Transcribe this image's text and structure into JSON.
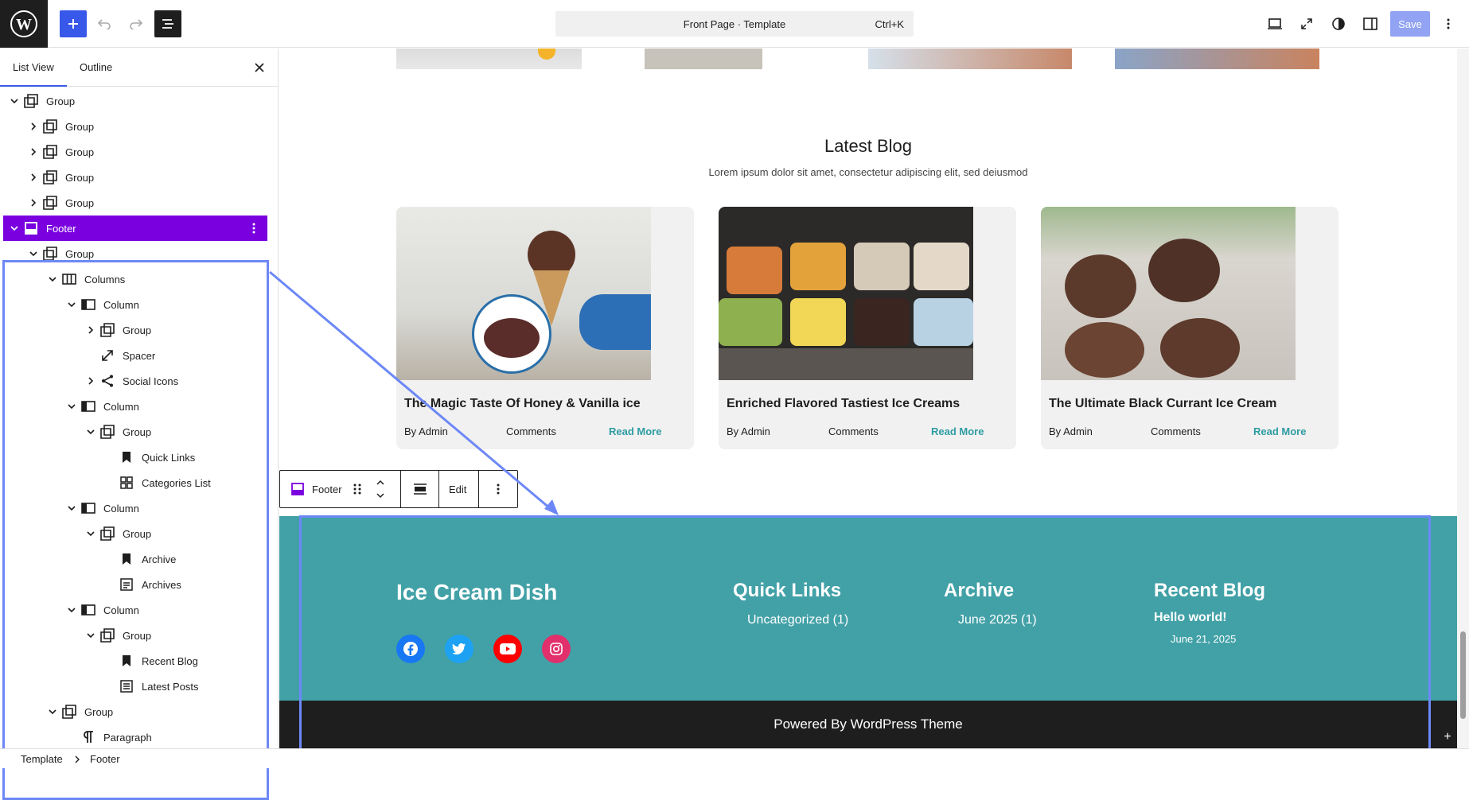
{
  "toolbar": {
    "command_title": "Front Page · Template",
    "command_shortcut": "Ctrl+K",
    "save_label": "Save"
  },
  "sidebar": {
    "tabs": [
      "List View",
      "Outline"
    ],
    "items": [
      {
        "label": "Group",
        "icon": "group-icon"
      },
      {
        "label": "Group",
        "icon": "group-icon"
      },
      {
        "label": "Group",
        "icon": "group-icon"
      },
      {
        "label": "Group",
        "icon": "group-icon"
      },
      {
        "label": "Group",
        "icon": "group-icon"
      },
      {
        "label": "Footer",
        "icon": "template-part-icon"
      },
      {
        "label": "Group",
        "icon": "group-icon"
      },
      {
        "label": "Columns",
        "icon": "columns-icon"
      },
      {
        "label": "Column",
        "icon": "column-icon"
      },
      {
        "label": "Group",
        "icon": "group-icon"
      },
      {
        "label": "Spacer",
        "icon": "spacer-icon"
      },
      {
        "label": "Social Icons",
        "icon": "share-icon"
      },
      {
        "label": "Column",
        "icon": "column-icon"
      },
      {
        "label": "Group",
        "icon": "group-icon"
      },
      {
        "label": "Quick Links",
        "icon": "bookmark-icon"
      },
      {
        "label": "Categories List",
        "icon": "categories-icon"
      },
      {
        "label": "Column",
        "icon": "column-icon"
      },
      {
        "label": "Group",
        "icon": "group-icon"
      },
      {
        "label": "Archive",
        "icon": "bookmark-icon"
      },
      {
        "label": "Archives",
        "icon": "archive-icon"
      },
      {
        "label": "Column",
        "icon": "column-icon"
      },
      {
        "label": "Group",
        "icon": "group-icon"
      },
      {
        "label": "Recent Blog",
        "icon": "bookmark-icon"
      },
      {
        "label": "Latest Posts",
        "icon": "post-list-icon"
      },
      {
        "label": "Group",
        "icon": "group-icon"
      },
      {
        "label": "Paragraph",
        "icon": "paragraph-icon"
      }
    ]
  },
  "breadcrumb": [
    "Template",
    "Footer"
  ],
  "blog": {
    "title": "Latest Blog",
    "subtitle": "Lorem ipsum dolor sit amet, consectetur adipiscing elit, sed deiusmod",
    "cards": [
      {
        "title": "The Magic Taste Of Honey & Vanilla ice",
        "author": "By Admin",
        "comments": "Comments",
        "read": "Read More"
      },
      {
        "title": "Enriched Flavored Tastiest Ice Creams",
        "author": "By Admin",
        "comments": "Comments",
        "read": "Read More"
      },
      {
        "title": "The Ultimate Black Currant Ice Cream",
        "author": "By Admin",
        "comments": "Comments",
        "read": "Read More"
      }
    ]
  },
  "block_toolbar": {
    "label": "Footer",
    "edit": "Edit"
  },
  "footer": {
    "site_title": "Ice Cream Dish",
    "quick_links_heading": "Quick Links",
    "quick_links_item": "Uncategorized (1)",
    "archive_heading": "Archive",
    "archive_item": "June 2025 (1)",
    "recent_heading": "Recent Blog",
    "recent_post": "Hello world!",
    "recent_date": "June 21, 2025",
    "powered": "Powered By WordPress Theme"
  },
  "colors": {
    "accent": "#3858e9",
    "selection": "#7a00df",
    "footer_bg": "#42a1a7",
    "footer_bottom": "#1e1e1e",
    "read_more": "#2e9ca3"
  }
}
